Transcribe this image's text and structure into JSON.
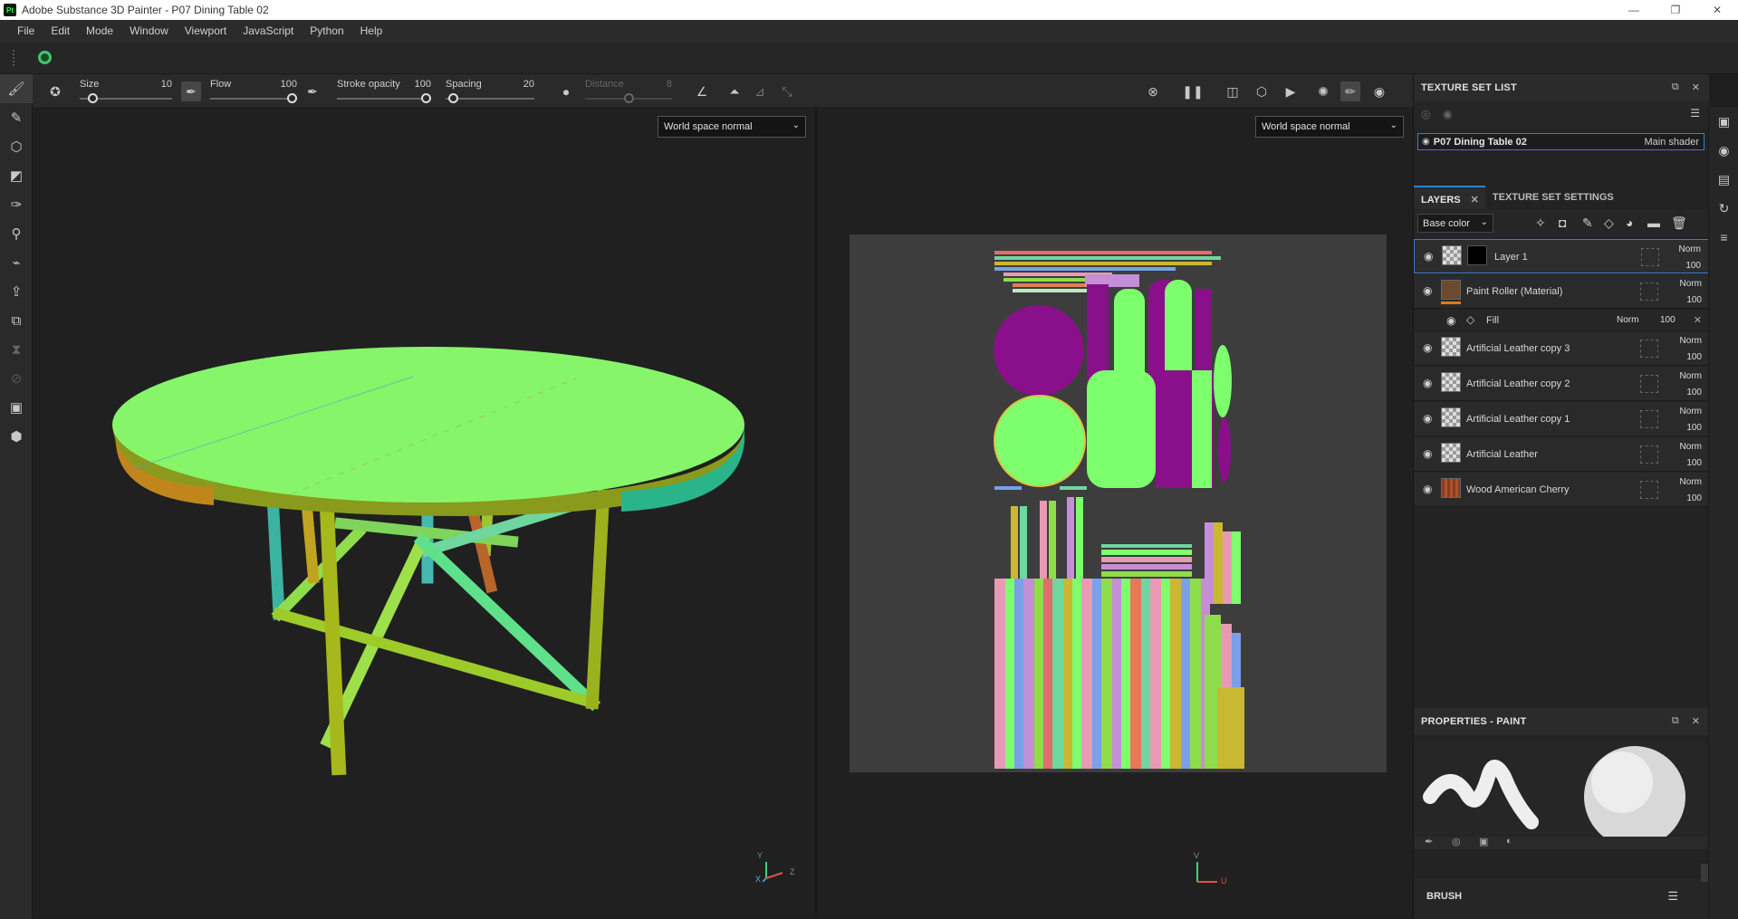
{
  "window": {
    "title": "Adobe Substance 3D Painter - P07 Dining Table 02",
    "logo": "Pt",
    "controls": {
      "minimize": "—",
      "maximize": "❐",
      "close": "✕"
    }
  },
  "menu": [
    "File",
    "Edit",
    "Mode",
    "Window",
    "Viewport",
    "JavaScript",
    "Python",
    "Help"
  ],
  "toolbar": {
    "size": {
      "label": "Size",
      "value": "10",
      "level": 0.1
    },
    "flow": {
      "label": "Flow",
      "value": "100",
      "level": 1.0
    },
    "stroke_opacity": {
      "label": "Stroke opacity",
      "value": "100",
      "level": 1.0
    },
    "spacing": {
      "label": "Spacing",
      "value": "20",
      "level": 0.03
    },
    "distance": {
      "label": "Distance",
      "value": "8",
      "level": 0.5,
      "disabled": true
    }
  },
  "viewports": {
    "view3d": {
      "channel": "World space normal",
      "axes": {
        "x": "X",
        "y": "Y",
        "z": "Z"
      }
    },
    "view2d": {
      "channel": "World space normal",
      "axes": {
        "v": "V",
        "u": "U"
      }
    }
  },
  "texture_set_list": {
    "title": "TEXTURE SET LIST",
    "item": {
      "name": "P07 Dining Table 02",
      "shader": "Main shader"
    }
  },
  "tabs": {
    "layers": "LAYERS",
    "texture_set_settings": "TEXTURE SET SETTINGS",
    "close": "✕"
  },
  "layer_filter": "Base color",
  "layers": [
    {
      "name": "Layer 1",
      "blend": "Norm",
      "opacity": "100"
    },
    {
      "name": "Paint Roller (Material)",
      "blend": "Norm",
      "opacity": "100"
    },
    {
      "name": "Artificial Leather copy 3",
      "blend": "Norm",
      "opacity": "100"
    },
    {
      "name": "Artificial Leather copy 2",
      "blend": "Norm",
      "opacity": "100"
    },
    {
      "name": "Artificial Leather copy 1",
      "blend": "Norm",
      "opacity": "100"
    },
    {
      "name": "Artificial Leather",
      "blend": "Norm",
      "opacity": "100"
    },
    {
      "name": "Wood American Cherry",
      "blend": "Norm",
      "opacity": "100"
    }
  ],
  "fill_effect": {
    "name": "Fill",
    "blend": "Norm",
    "opacity": "100"
  },
  "properties": {
    "title": "PROPERTIES - PAINT",
    "brush_section": "BRUSH"
  },
  "colors": {
    "accent": "#3a7bd5",
    "normal_green": "#7dff6e"
  }
}
